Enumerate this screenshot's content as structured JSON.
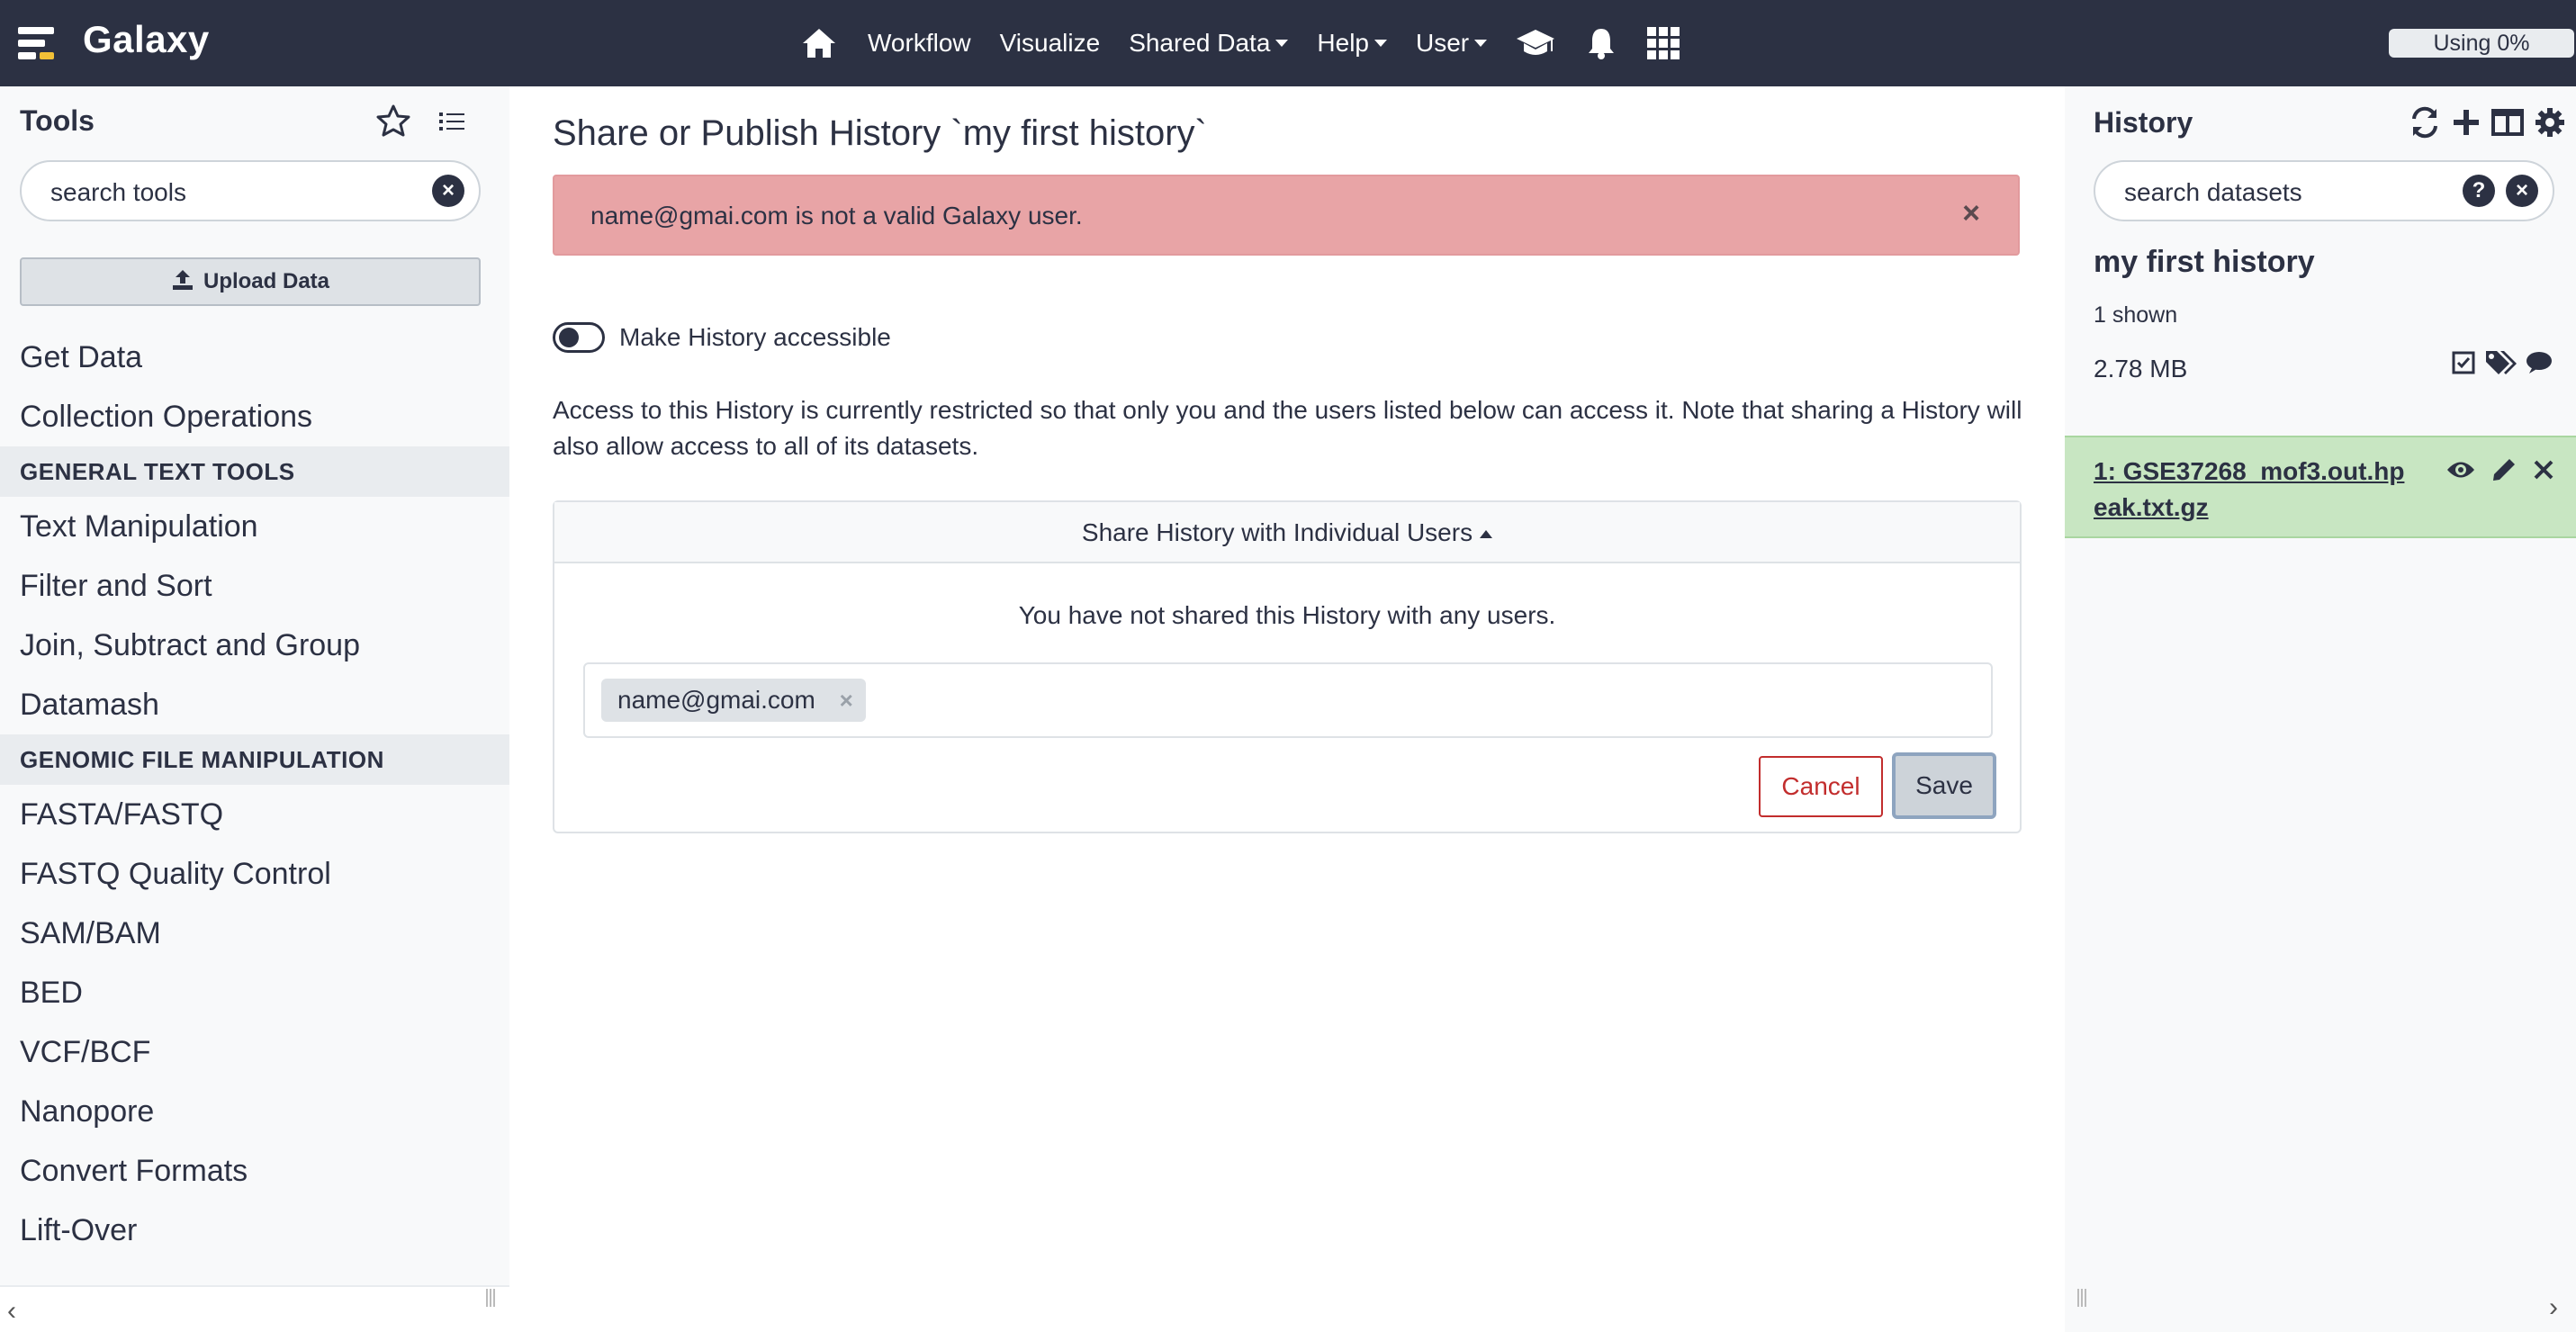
{
  "masthead": {
    "brand": "Galaxy",
    "nav": {
      "workflow": "Workflow",
      "visualize": "Visualize",
      "shared_data": "Shared Data",
      "help": "Help",
      "user": "User"
    },
    "quota": "Using 0%"
  },
  "tool_panel": {
    "title": "Tools",
    "search_placeholder": "search tools",
    "upload_label": "Upload Data",
    "items": [
      {
        "kind": "tool",
        "label": "Get Data"
      },
      {
        "kind": "tool",
        "label": "Collection Operations"
      },
      {
        "kind": "section",
        "label": "GENERAL TEXT TOOLS"
      },
      {
        "kind": "tool",
        "label": "Text Manipulation"
      },
      {
        "kind": "tool",
        "label": "Filter and Sort"
      },
      {
        "kind": "tool",
        "label": "Join, Subtract and Group"
      },
      {
        "kind": "tool",
        "label": "Datamash"
      },
      {
        "kind": "section",
        "label": "GENOMIC FILE MANIPULATION"
      },
      {
        "kind": "tool",
        "label": "FASTA/FASTQ"
      },
      {
        "kind": "tool",
        "label": "FASTQ Quality Control"
      },
      {
        "kind": "tool",
        "label": "SAM/BAM"
      },
      {
        "kind": "tool",
        "label": "BED"
      },
      {
        "kind": "tool",
        "label": "VCF/BCF"
      },
      {
        "kind": "tool",
        "label": "Nanopore"
      },
      {
        "kind": "tool",
        "label": "Convert Formats"
      },
      {
        "kind": "tool",
        "label": "Lift-Over"
      }
    ]
  },
  "center": {
    "title": "Share or Publish History `my first history`",
    "alert": {
      "text": "name@gmai.com is not a valid Galaxy user.",
      "close": "×"
    },
    "toggle_label": "Make History accessible",
    "description": "Access to this History is currently restricted so that only you and the users listed below can access it. Note that sharing a History will also allow access to all of its datasets.",
    "share_card": {
      "header": "Share History with Individual Users",
      "empty_message": "You have not shared this History with any users.",
      "user_tag": "name@gmai.com",
      "tag_remove": "×",
      "cancel_label": "Cancel",
      "save_label": "Save"
    }
  },
  "history_panel": {
    "title": "History",
    "search_placeholder": "search datasets",
    "name": "my first history",
    "shown": "1 shown",
    "size": "2.78 MB",
    "datasets": [
      {
        "label": "1: GSE37268_mof3.out.hpeak.txt.gz",
        "state_color": "#c8e6c2"
      }
    ]
  },
  "colors": {
    "masthead": "#2c3143",
    "alert_danger": "#e8a4a6",
    "dataset_ok": "#c8e6c2",
    "cancel": "#c22d2d"
  }
}
